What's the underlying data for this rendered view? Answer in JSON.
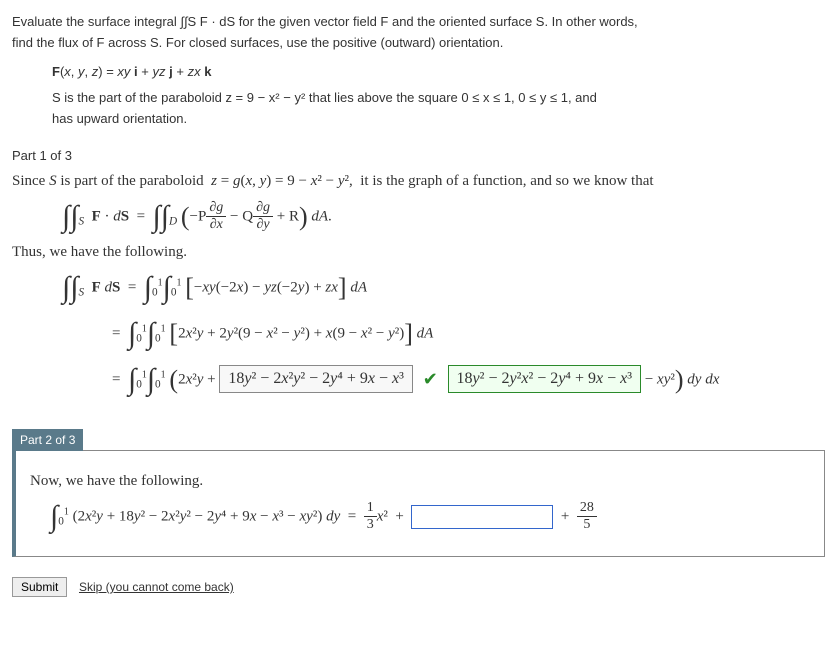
{
  "problem": {
    "intro1": "Evaluate the surface integral ∫∫S F · dS for the given vector field F and the oriented surface S. In other words,",
    "intro2": "find the flux of F across S. For closed surfaces, use the positive (outward) orientation.",
    "field": "F(x, y, z) = xy i + yz j + zx k",
    "surface1": "S is the part of the paraboloid z = 9 − x² − y² that lies above the square 0 ≤ x ≤ 1, 0 ≤ y ≤ 1, and",
    "surface2": "has upward orientation."
  },
  "part1": {
    "header": "Part 1 of 3",
    "line1a": "Since S is part of the paraboloid  z = g(x, y) = 9 − x² − y²,  it is the graph of a function, and so we know that",
    "formula1": "∫∫S  F · dS  =  ∫∫D ( −P ∂g/∂x − Q ∂g/∂y + R ) dA.",
    "line2": "Thus, we have the following.",
    "eq_lhs": "∫∫S  F dS  =",
    "eq_rhs1": "∫₀¹ ∫₀¹ [ −xy(−2x) − yz(−2y) + zx ] dA",
    "eq_rhs2": "=  ∫₀¹ ∫₀¹ [ 2x²y + 2y²(9 − x² − y²) + x(9 − x² − y²) ] dA",
    "eq_rhs3_pre": "=  ∫₀¹ ∫₀¹ ( 2x²y + ",
    "answer_box": "18y² − 2x²y² − 2y⁴ + 9x − x³",
    "eq_rhs3_post": " − xy² ) dy dx",
    "green_box": "18y² − 2y²x² − 2y⁴ + 9x − x³"
  },
  "part2": {
    "header": "Part 2 of 3",
    "line1": "Now, we have the following.",
    "eq_pre": "∫₀¹ (2x²y + 18y² − 2x²y² − 2y⁴ + 9x − x³ − xy²) dy  =  ",
    "frac1_num": "1",
    "frac1_den": "3",
    "mid": "x²  +",
    "plus": "+",
    "frac2_num": "28",
    "frac2_den": "5"
  },
  "buttons": {
    "submit": "Submit",
    "skip": "Skip (you cannot come back)"
  }
}
